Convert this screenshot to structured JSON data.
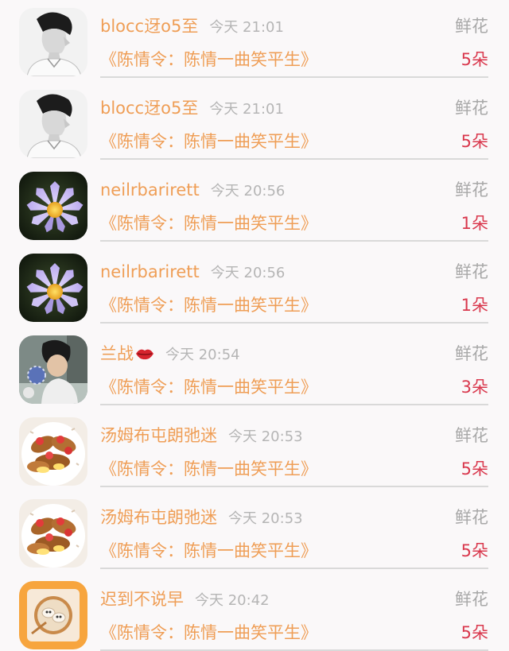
{
  "gift_records": [
    {
      "user": "blocc迓o5至",
      "time": "今天 21:01",
      "gift_type": "鲜花",
      "work": "《陈情令：陈情一曲笑平生》",
      "count": "5朵",
      "avatar": "boy-profile-bw"
    },
    {
      "user": "blocc迓o5至",
      "time": "今天 21:01",
      "gift_type": "鲜花",
      "work": "《陈情令：陈情一曲笑平生》",
      "count": "5朵",
      "avatar": "boy-profile-bw"
    },
    {
      "user": "neilrbarirett",
      "time": "今天 20:56",
      "gift_type": "鲜花",
      "work": "《陈情令：陈情一曲笑平生》",
      "count": "1朵",
      "avatar": "water-lily"
    },
    {
      "user": "neilrbarirett",
      "time": "今天 20:56",
      "gift_type": "鲜花",
      "work": "《陈情令：陈情一曲笑平生》",
      "count": "1朵",
      "avatar": "water-lily"
    },
    {
      "user": "兰战",
      "time": "今天 20:54",
      "gift_type": "鲜花",
      "work": "《陈情令：陈情一曲笑平生》",
      "count": "3朵",
      "avatar": "man-with-toy",
      "name_icon": "lips-icon"
    },
    {
      "user": "汤姆布屯朗弛迷",
      "time": "今天 20:53",
      "gift_type": "鲜花",
      "work": "《陈情令：陈情一曲笑平生》",
      "count": "5朵",
      "avatar": "strawberry-pastry"
    },
    {
      "user": "汤姆布屯朗弛迷",
      "time": "今天 20:53",
      "gift_type": "鲜花",
      "work": "《陈情令：陈情一曲笑平生》",
      "count": "5朵",
      "avatar": "strawberry-pastry"
    },
    {
      "user": "迟到不说早",
      "time": "今天 20:42",
      "gift_type": "鲜花",
      "work": "《陈情令：陈情一曲笑平生》",
      "count": "5朵",
      "avatar": "dumpling-plate"
    }
  ],
  "colors": {
    "username": "#ef9e56",
    "time": "#b5b5b5",
    "gift_type": "#a8a8a8",
    "count": "#d9384d",
    "divider": "#d9d9d9"
  }
}
